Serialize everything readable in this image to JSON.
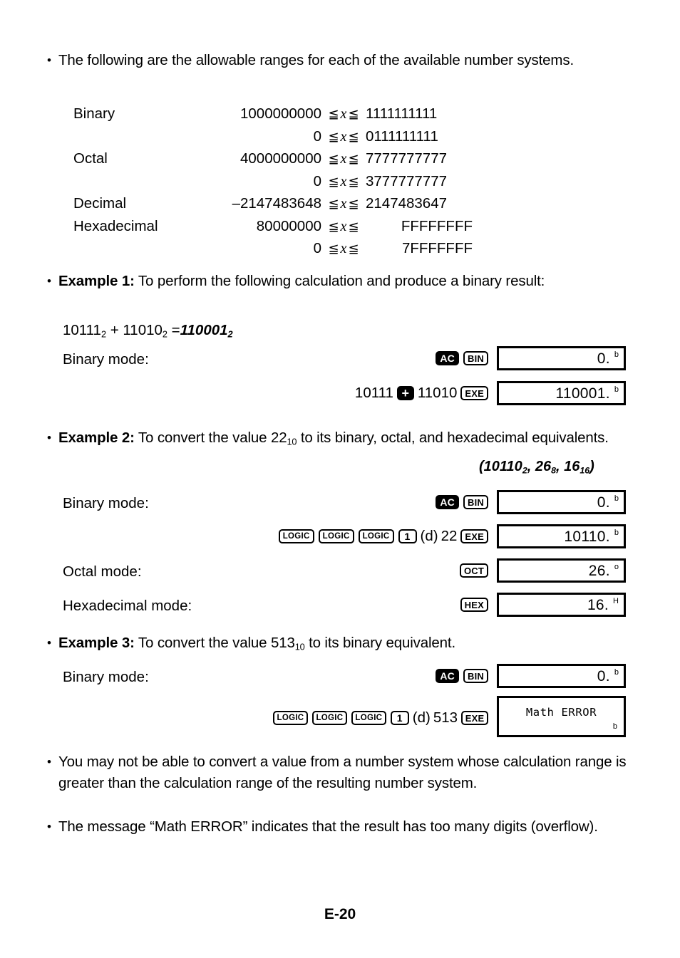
{
  "intro": {
    "bullet": "•",
    "text": "The following are the allowable ranges for each of the available number systems."
  },
  "ranges": {
    "variable": "x",
    "operator": "≦",
    "rows": [
      {
        "name": "Binary",
        "low": "1000000000",
        "high": "1111111111",
        "align": "left"
      },
      {
        "name": "",
        "low": "0",
        "high": "0111111111",
        "align": "left"
      },
      {
        "name": "Octal",
        "low": "4000000000",
        "high": "7777777777",
        "align": "left"
      },
      {
        "name": "",
        "low": "0",
        "high": "3777777777",
        "align": "left"
      },
      {
        "name": "Decimal",
        "low": "–2147483648",
        "high": "2147483647",
        "align": "left"
      },
      {
        "name": "Hexadecimal",
        "low": "80000000",
        "high": "FFFFFFFF",
        "align": "right"
      },
      {
        "name": "",
        "low": "0",
        "high": "7FFFFFFF",
        "align": "right"
      }
    ]
  },
  "example1": {
    "bullet": "•",
    "label": "Example 1:",
    "text": " To perform the following calculation and produce a binary result:",
    "expression": {
      "a": "10111",
      "a_sub": "2",
      "op": " + ",
      "b": "11010",
      "b_sub": "2",
      "eq": " =",
      "result": "110001",
      "result_sub": "2"
    },
    "mode_label": "Binary mode:",
    "keys_row1": [
      {
        "type": "key-ac",
        "label": "AC"
      },
      {
        "type": "key",
        "label": "BIN",
        "style": "k-bin"
      }
    ],
    "display1": {
      "value": "0.",
      "tag": "b"
    },
    "keys_row2": [
      {
        "type": "text",
        "label": "10111"
      },
      {
        "type": "key-plus",
        "label": "+"
      },
      {
        "type": "text",
        "label": "11010"
      },
      {
        "type": "key",
        "label": "EXE",
        "style": "k-exe"
      }
    ],
    "display2": {
      "value": "110001.",
      "tag": "b"
    }
  },
  "example2": {
    "bullet": "•",
    "label": "Example 2:",
    "text_part1": " To convert the value 22",
    "text_sub1": "10",
    "text_part2": " to its binary, octal, and hexadecimal equivalents.",
    "answer": {
      "open": "(",
      "v1": "10110",
      "s1": "2",
      "c1": ", ",
      "v2": "26",
      "s2": "8",
      "c2": ", ",
      "v3": "16",
      "s3": "16",
      "close": ")"
    },
    "rows": [
      {
        "mode_label": "Binary mode:",
        "keys": [
          {
            "type": "key-ac",
            "label": "AC"
          },
          {
            "type": "key",
            "label": "BIN",
            "style": "k-bin"
          }
        ],
        "display": {
          "value": "0.",
          "tag": "b"
        }
      },
      {
        "mode_label": "",
        "keys": [
          {
            "type": "key",
            "label": "LOGIC",
            "style": "k-logic"
          },
          {
            "type": "key",
            "label": "LOGIC",
            "style": "k-logic"
          },
          {
            "type": "key",
            "label": "LOGIC",
            "style": "k-logic"
          },
          {
            "type": "key",
            "label": "1",
            "style": "k-num"
          },
          {
            "type": "text",
            "label": "(d)"
          },
          {
            "type": "text",
            "label": "22"
          },
          {
            "type": "key",
            "label": "EXE",
            "style": "k-exe"
          }
        ],
        "display": {
          "value": "10110.",
          "tag": "b"
        }
      },
      {
        "mode_label": "Octal mode:",
        "keys": [
          {
            "type": "key",
            "label": "OCT",
            "style": "k-oct"
          }
        ],
        "display": {
          "value": "26.",
          "tag": "o"
        }
      },
      {
        "mode_label": "Hexadecimal mode:",
        "keys": [
          {
            "type": "key",
            "label": "HEX",
            "style": "k-hex"
          }
        ],
        "display": {
          "value": "16.",
          "tag": "H"
        }
      }
    ]
  },
  "example3": {
    "bullet": "•",
    "label": "Example 3:",
    "text_part1": " To convert the value 513",
    "text_sub1": "10",
    "text_part2": " to its binary equivalent.",
    "mode_label": "Binary mode:",
    "keys_row1": [
      {
        "type": "key-ac",
        "label": "AC"
      },
      {
        "type": "key",
        "label": "BIN",
        "style": "k-bin"
      }
    ],
    "display1": {
      "value": "0.",
      "tag": "b"
    },
    "keys_row2": [
      {
        "type": "key",
        "label": "LOGIC",
        "style": "k-logic"
      },
      {
        "type": "key",
        "label": "LOGIC",
        "style": "k-logic"
      },
      {
        "type": "key",
        "label": "LOGIC",
        "style": "k-logic"
      },
      {
        "type": "key",
        "label": "1",
        "style": "k-num"
      },
      {
        "type": "text",
        "label": "(d)"
      },
      {
        "type": "text",
        "label": "513"
      },
      {
        "type": "key",
        "label": "EXE",
        "style": "k-exe"
      }
    ],
    "display2": {
      "value": "Math ERROR",
      "tag": "b"
    }
  },
  "notes": [
    {
      "bullet": "•",
      "text": "You may not be able to convert a value from a number system whose calculation range is greater than the calculation range of the resulting number system."
    },
    {
      "bullet": "•",
      "text": "The message “Math ERROR” indicates that the result has too many digits (overflow)."
    }
  ],
  "footer": {
    "page_number": "E-20"
  }
}
